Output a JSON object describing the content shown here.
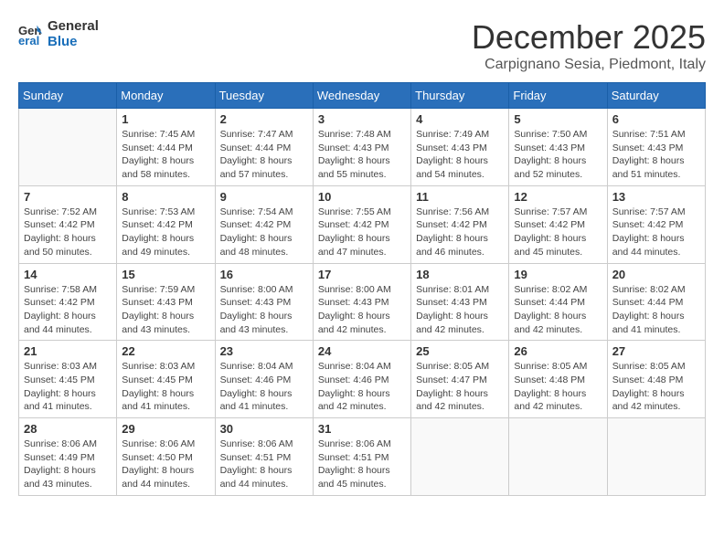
{
  "header": {
    "logo_line1": "General",
    "logo_line2": "Blue",
    "month": "December 2025",
    "location": "Carpignano Sesia, Piedmont, Italy"
  },
  "weekdays": [
    "Sunday",
    "Monday",
    "Tuesday",
    "Wednesday",
    "Thursday",
    "Friday",
    "Saturday"
  ],
  "weeks": [
    [
      {
        "day": "",
        "info": ""
      },
      {
        "day": "1",
        "info": "Sunrise: 7:45 AM\nSunset: 4:44 PM\nDaylight: 8 hours\nand 58 minutes."
      },
      {
        "day": "2",
        "info": "Sunrise: 7:47 AM\nSunset: 4:44 PM\nDaylight: 8 hours\nand 57 minutes."
      },
      {
        "day": "3",
        "info": "Sunrise: 7:48 AM\nSunset: 4:43 PM\nDaylight: 8 hours\nand 55 minutes."
      },
      {
        "day": "4",
        "info": "Sunrise: 7:49 AM\nSunset: 4:43 PM\nDaylight: 8 hours\nand 54 minutes."
      },
      {
        "day": "5",
        "info": "Sunrise: 7:50 AM\nSunset: 4:43 PM\nDaylight: 8 hours\nand 52 minutes."
      },
      {
        "day": "6",
        "info": "Sunrise: 7:51 AM\nSunset: 4:43 PM\nDaylight: 8 hours\nand 51 minutes."
      }
    ],
    [
      {
        "day": "7",
        "info": "Sunrise: 7:52 AM\nSunset: 4:42 PM\nDaylight: 8 hours\nand 50 minutes."
      },
      {
        "day": "8",
        "info": "Sunrise: 7:53 AM\nSunset: 4:42 PM\nDaylight: 8 hours\nand 49 minutes."
      },
      {
        "day": "9",
        "info": "Sunrise: 7:54 AM\nSunset: 4:42 PM\nDaylight: 8 hours\nand 48 minutes."
      },
      {
        "day": "10",
        "info": "Sunrise: 7:55 AM\nSunset: 4:42 PM\nDaylight: 8 hours\nand 47 minutes."
      },
      {
        "day": "11",
        "info": "Sunrise: 7:56 AM\nSunset: 4:42 PM\nDaylight: 8 hours\nand 46 minutes."
      },
      {
        "day": "12",
        "info": "Sunrise: 7:57 AM\nSunset: 4:42 PM\nDaylight: 8 hours\nand 45 minutes."
      },
      {
        "day": "13",
        "info": "Sunrise: 7:57 AM\nSunset: 4:42 PM\nDaylight: 8 hours\nand 44 minutes."
      }
    ],
    [
      {
        "day": "14",
        "info": "Sunrise: 7:58 AM\nSunset: 4:42 PM\nDaylight: 8 hours\nand 44 minutes."
      },
      {
        "day": "15",
        "info": "Sunrise: 7:59 AM\nSunset: 4:43 PM\nDaylight: 8 hours\nand 43 minutes."
      },
      {
        "day": "16",
        "info": "Sunrise: 8:00 AM\nSunset: 4:43 PM\nDaylight: 8 hours\nand 43 minutes."
      },
      {
        "day": "17",
        "info": "Sunrise: 8:00 AM\nSunset: 4:43 PM\nDaylight: 8 hours\nand 42 minutes."
      },
      {
        "day": "18",
        "info": "Sunrise: 8:01 AM\nSunset: 4:43 PM\nDaylight: 8 hours\nand 42 minutes."
      },
      {
        "day": "19",
        "info": "Sunrise: 8:02 AM\nSunset: 4:44 PM\nDaylight: 8 hours\nand 42 minutes."
      },
      {
        "day": "20",
        "info": "Sunrise: 8:02 AM\nSunset: 4:44 PM\nDaylight: 8 hours\nand 41 minutes."
      }
    ],
    [
      {
        "day": "21",
        "info": "Sunrise: 8:03 AM\nSunset: 4:45 PM\nDaylight: 8 hours\nand 41 minutes."
      },
      {
        "day": "22",
        "info": "Sunrise: 8:03 AM\nSunset: 4:45 PM\nDaylight: 8 hours\nand 41 minutes."
      },
      {
        "day": "23",
        "info": "Sunrise: 8:04 AM\nSunset: 4:46 PM\nDaylight: 8 hours\nand 41 minutes."
      },
      {
        "day": "24",
        "info": "Sunrise: 8:04 AM\nSunset: 4:46 PM\nDaylight: 8 hours\nand 42 minutes."
      },
      {
        "day": "25",
        "info": "Sunrise: 8:05 AM\nSunset: 4:47 PM\nDaylight: 8 hours\nand 42 minutes."
      },
      {
        "day": "26",
        "info": "Sunrise: 8:05 AM\nSunset: 4:48 PM\nDaylight: 8 hours\nand 42 minutes."
      },
      {
        "day": "27",
        "info": "Sunrise: 8:05 AM\nSunset: 4:48 PM\nDaylight: 8 hours\nand 42 minutes."
      }
    ],
    [
      {
        "day": "28",
        "info": "Sunrise: 8:06 AM\nSunset: 4:49 PM\nDaylight: 8 hours\nand 43 minutes."
      },
      {
        "day": "29",
        "info": "Sunrise: 8:06 AM\nSunset: 4:50 PM\nDaylight: 8 hours\nand 44 minutes."
      },
      {
        "day": "30",
        "info": "Sunrise: 8:06 AM\nSunset: 4:51 PM\nDaylight: 8 hours\nand 44 minutes."
      },
      {
        "day": "31",
        "info": "Sunrise: 8:06 AM\nSunset: 4:51 PM\nDaylight: 8 hours\nand 45 minutes."
      },
      {
        "day": "",
        "info": ""
      },
      {
        "day": "",
        "info": ""
      },
      {
        "day": "",
        "info": ""
      }
    ]
  ]
}
